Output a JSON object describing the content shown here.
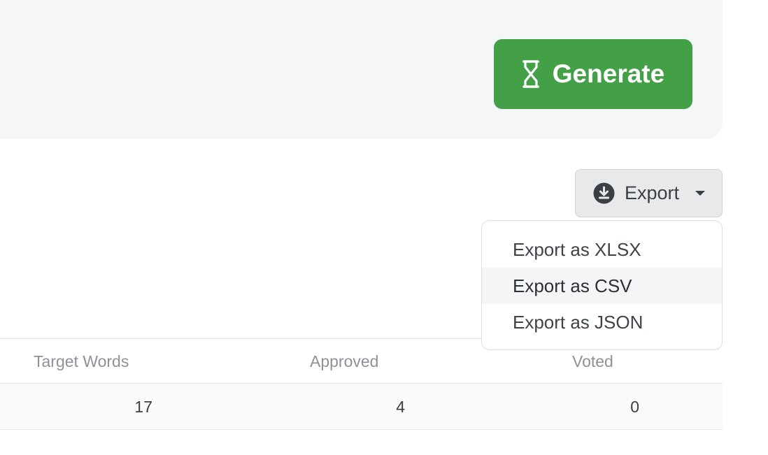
{
  "generate": {
    "label": "Generate",
    "icon": "hourglass-icon",
    "color": "#44a047"
  },
  "export": {
    "label": "Export",
    "icon": "download-circle-icon",
    "menu": [
      {
        "label": "Export as XLSX"
      },
      {
        "label": "Export as CSV"
      },
      {
        "label": "Export as JSON"
      }
    ]
  },
  "table": {
    "headers": [
      "Target Words",
      "Approved",
      "Voted"
    ],
    "rows": [
      [
        "17",
        "4",
        "0"
      ]
    ]
  }
}
